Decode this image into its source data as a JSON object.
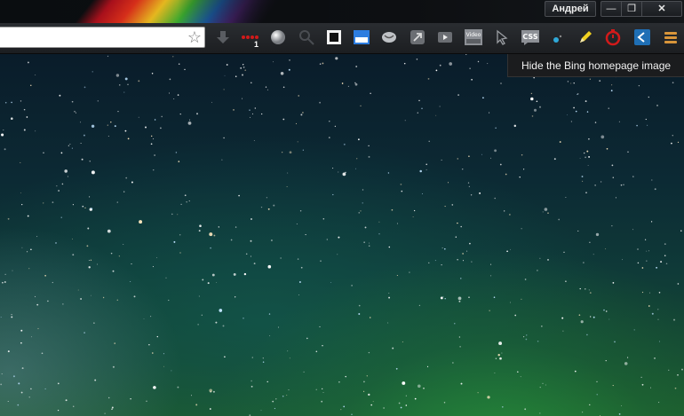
{
  "window": {
    "profile_name": "Андрей",
    "minimize_glyph": "—",
    "restore_glyph": "❐",
    "close_glyph": "✕"
  },
  "omnibox": {
    "value": "",
    "star_glyph": "☆"
  },
  "extensions": [
    {
      "name": "download-icon"
    },
    {
      "name": "dots-extension-icon",
      "badge": "1"
    },
    {
      "name": "globe-icon"
    },
    {
      "name": "search-extension-icon"
    },
    {
      "name": "window-icon"
    },
    {
      "name": "screenshot-extension-icon"
    },
    {
      "name": "chat-bubble-icon"
    },
    {
      "name": "share-arrow-icon"
    },
    {
      "name": "video-icon"
    },
    {
      "name": "video-downloader-icon",
      "text": "Video"
    },
    {
      "name": "cursor-icon"
    },
    {
      "name": "css-icon",
      "text": "CSS"
    },
    {
      "name": "dot-color-icon"
    },
    {
      "name": "pencil-icon"
    },
    {
      "name": "timer-icon"
    },
    {
      "name": "feedly-icon"
    },
    {
      "name": "menu-icon"
    }
  ],
  "tooltip": {
    "text": "Hide the Bing homepage image"
  },
  "colors": {
    "accent_red": "#d21a1a",
    "tooltip_bg": "#1b1c1e",
    "sky_green": "#1d5a2c"
  }
}
